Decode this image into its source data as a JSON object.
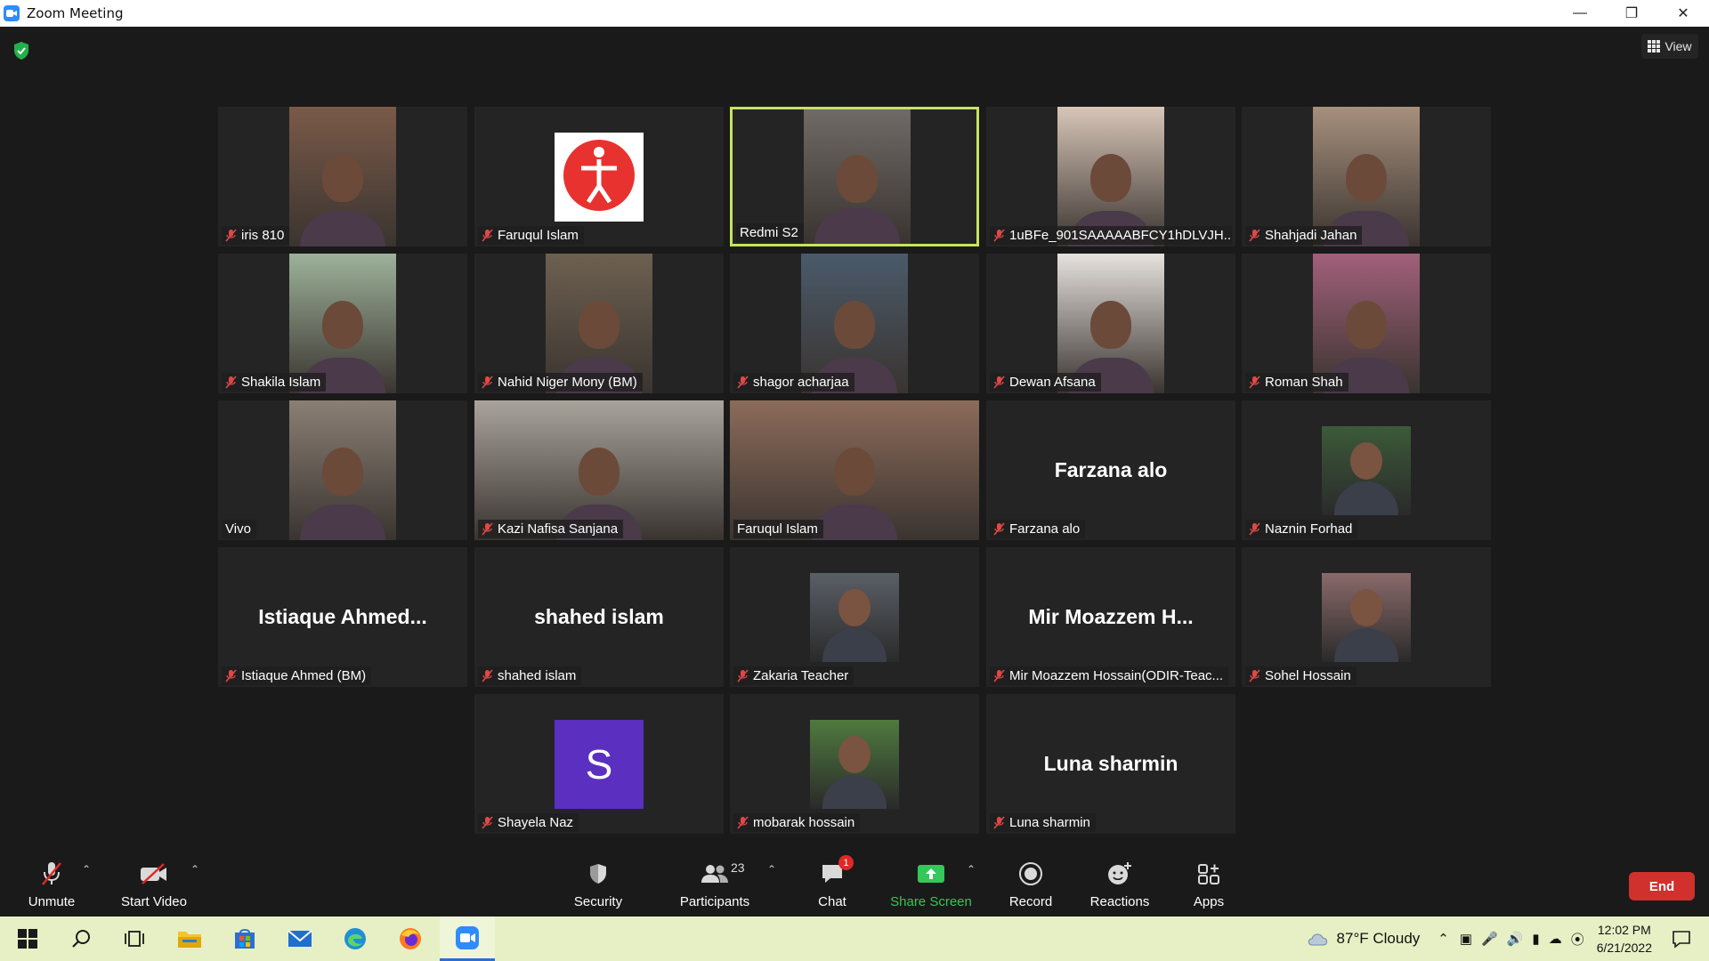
{
  "window": {
    "title": "Zoom Meeting"
  },
  "header": {
    "view_label": "View"
  },
  "participants": [
    {
      "name": "iris 810",
      "muted": true,
      "type": "video",
      "bg": "#7a5a48"
    },
    {
      "name": "Faruqul Islam",
      "muted": true,
      "type": "logo"
    },
    {
      "name": "Redmi S2",
      "muted": false,
      "type": "video",
      "bg": "#6f6a66",
      "active": true
    },
    {
      "name": "1uBFe_901SAAAAABFCY1hDLVJH...",
      "muted": true,
      "type": "video",
      "bg": "#d8c6b8"
    },
    {
      "name": "Shahjadi Jahan",
      "muted": true,
      "type": "video",
      "bg": "#a7907c"
    },
    {
      "name": "Shakila Islam",
      "muted": true,
      "type": "video",
      "bg": "#9db29a"
    },
    {
      "name": "Nahid Niger Mony (BM)",
      "muted": true,
      "type": "video",
      "bg": "#6d6050"
    },
    {
      "name": "shagor acharjaa",
      "muted": true,
      "type": "video",
      "bg": "#4a5a6a"
    },
    {
      "name": "Dewan Afsana",
      "muted": true,
      "type": "video",
      "bg": "#e6e2de"
    },
    {
      "name": "Roman Shah",
      "muted": true,
      "type": "video",
      "bg": "#a1607a"
    },
    {
      "name": "Vivo",
      "muted": false,
      "type": "video",
      "bg": "#8a7f74"
    },
    {
      "name": "Kazi Nafisa Sanjana",
      "muted": true,
      "type": "video-wide",
      "bg": "#a8a49c"
    },
    {
      "name": "Faruqul Islam",
      "muted": false,
      "type": "video-wide",
      "bg": "#8c6b5a"
    },
    {
      "name": "Farzana alo",
      "muted": true,
      "type": "text",
      "display": "Farzana alo"
    },
    {
      "name": "Naznin Forhad",
      "muted": true,
      "type": "photo",
      "bg": "#3c5a3a"
    },
    {
      "name": "Istiaque Ahmed (BM)",
      "muted": true,
      "type": "text",
      "display": "Istiaque  Ahmed..."
    },
    {
      "name": "shahed islam",
      "muted": true,
      "type": "text",
      "display": "shahed islam"
    },
    {
      "name": "Zakaria Teacher",
      "muted": true,
      "type": "photo",
      "bg": "#5a5f66"
    },
    {
      "name": "Mir Moazzem Hossain(ODIR-Teac...",
      "muted": true,
      "type": "text",
      "display": "Mir  Moazzem  H..."
    },
    {
      "name": "Sohel Hossain",
      "muted": true,
      "type": "photo",
      "bg": "#8a6a6a"
    },
    {
      "name": "Shayela Naz",
      "muted": true,
      "type": "letter",
      "letter": "S"
    },
    {
      "name": "mobarak hossain",
      "muted": true,
      "type": "photo",
      "bg": "#4f7a3e"
    },
    {
      "name": "Luna sharmin",
      "muted": true,
      "type": "text",
      "display": "Luna sharmin"
    }
  ],
  "toolbar": {
    "unmute": "Unmute",
    "start_video": "Start Video",
    "security": "Security",
    "participants": "Participants",
    "participants_count": "23",
    "chat": "Chat",
    "chat_badge": "1",
    "share_screen": "Share Screen",
    "record": "Record",
    "reactions": "Reactions",
    "apps": "Apps",
    "end": "End"
  },
  "taskbar": {
    "weather": "87°F  Cloudy",
    "time": "12:02 PM",
    "date": "6/21/2022"
  },
  "colors": {
    "accent_green": "#34c759",
    "end_red": "#d0312d",
    "active_speaker": "#c5e55c",
    "letter_avatar": "#5b2fbf"
  }
}
